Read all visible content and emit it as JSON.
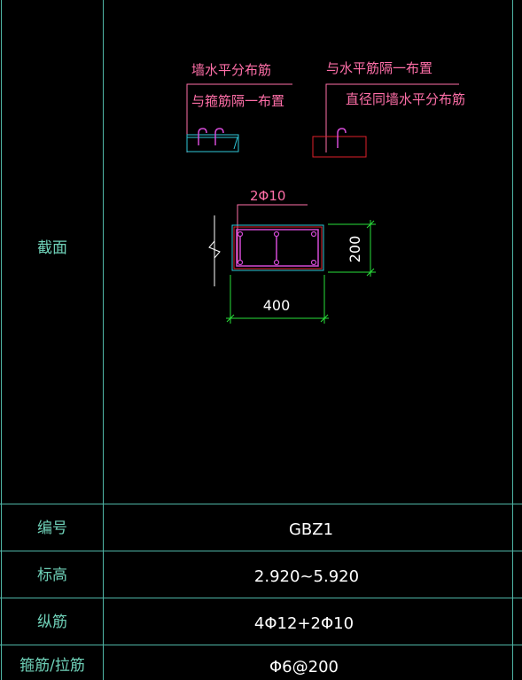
{
  "colors": {
    "background": "#000000",
    "grid_line": "#4fb6a6",
    "label_text": "#6fd1b8",
    "value_text": "#ffffff",
    "annotation_text": "#ff6fa8",
    "leader_line": "#ff6fa8",
    "rebar_magenta": "#d44bd6",
    "section_cyan": "#2fc7d8",
    "section_red": "#e0202a",
    "dimension_green": "#29e03a",
    "wall_white": "#ffffff"
  },
  "table": {
    "rows": [
      {
        "label": "截面",
        "value": ""
      },
      {
        "label": "编号",
        "value": "GBZ1"
      },
      {
        "label": "标高",
        "value": "2.920~5.920"
      },
      {
        "label": "纵筋",
        "value": "4Φ12+2Φ10"
      },
      {
        "label": "箍筋/拉筋",
        "value": "Φ6@200"
      }
    ]
  },
  "section_drawing": {
    "note_left": {
      "line1": "墙水平分布筋",
      "line2": "与箍筋隔一布置"
    },
    "note_right": {
      "line1": "与水平筋隔一布置",
      "line2": "直径同墙水平分布筋"
    },
    "rebar_callout": "2Φ10",
    "dim_width": "400",
    "dim_height": "200"
  }
}
